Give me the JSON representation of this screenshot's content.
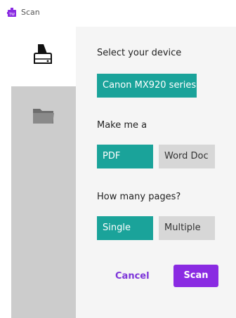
{
  "app": {
    "title": "Scan",
    "icon_text": "TW"
  },
  "sidebar": {
    "items": [
      {
        "name": "device",
        "icon": "scanner-icon",
        "selected": true
      },
      {
        "name": "files",
        "icon": "folder-icon",
        "selected": false
      }
    ]
  },
  "form": {
    "device": {
      "label": "Select your device",
      "value": "Canon MX920 series"
    },
    "format": {
      "label": "Make me a",
      "options": [
        "PDF",
        "Word Doc"
      ],
      "selected": "PDF"
    },
    "pages": {
      "label": "How many pages?",
      "options": [
        "Single",
        "Multiple"
      ],
      "selected": "Single"
    }
  },
  "actions": {
    "cancel": "Cancel",
    "scan": "Scan"
  },
  "colors": {
    "accent": "#1aa39a",
    "primary": "#8a2be2",
    "unselected": "#d7d7d7"
  }
}
